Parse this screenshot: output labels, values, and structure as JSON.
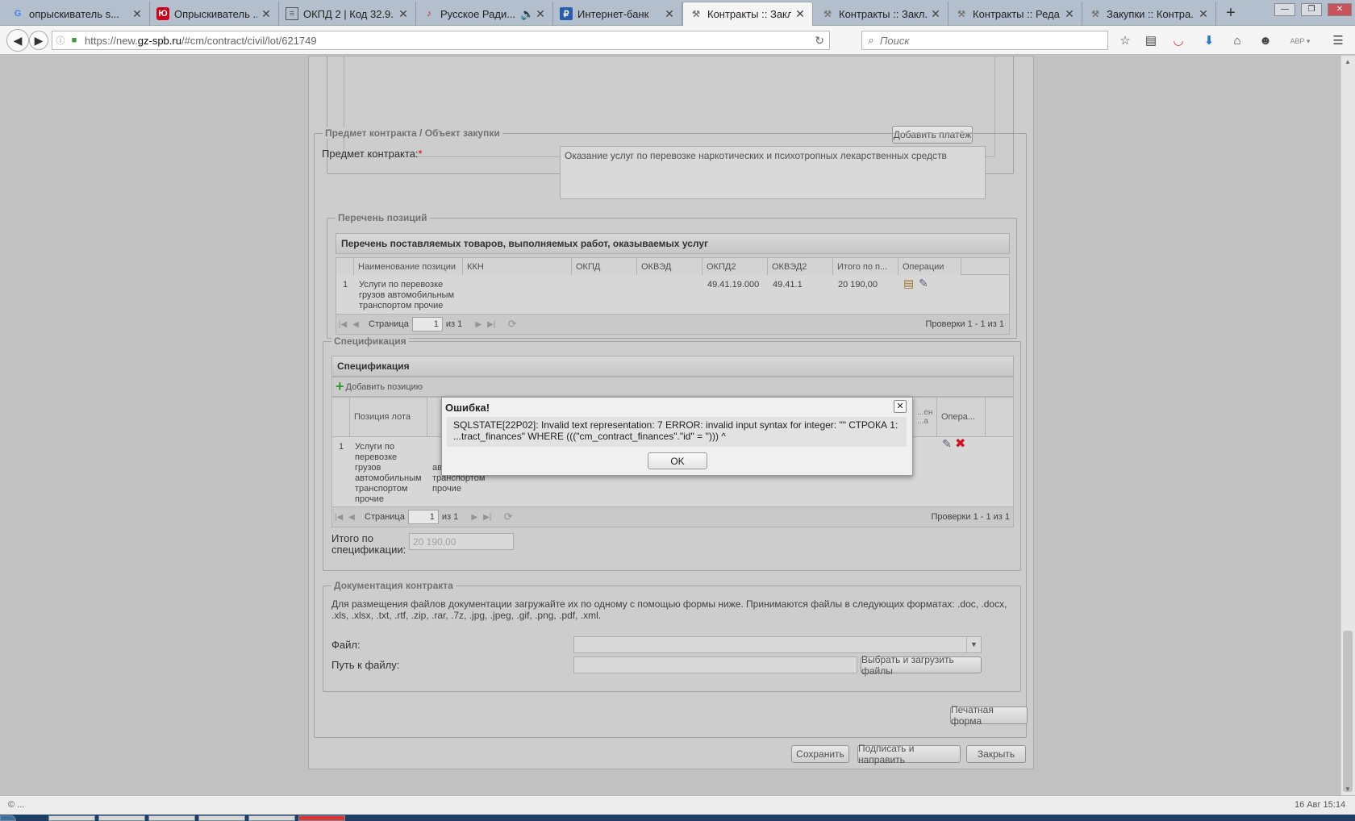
{
  "browser": {
    "tabs": [
      {
        "title": "опрыскиватель s...",
        "icon": "google-icon",
        "color": "#4285f4"
      },
      {
        "title": "Опрыскиватель ...",
        "icon": "yu-logo-icon",
        "color": "#d0021b"
      },
      {
        "title": "ОКПД 2 | Код 32.9...",
        "icon": "document-icon",
        "color": "#555555"
      },
      {
        "title": "Русское Ради...",
        "icon": "radio-icon",
        "color": "#c8102e"
      },
      {
        "title": "Интернет-банк",
        "icon": "bank-icon",
        "color": "#2a5db0"
      },
      {
        "title": "Контракты :: Закл...",
        "icon": "hammer-icon",
        "color": "#777777",
        "active": true
      },
      {
        "title": "Контракты :: Закл...",
        "icon": "hammer-icon",
        "color": "#777777"
      },
      {
        "title": "Контракты :: Реда...",
        "icon": "hammer-icon",
        "color": "#777777"
      },
      {
        "title": "Закупки :: Контра...",
        "icon": "hammer-icon",
        "color": "#777777"
      }
    ],
    "new_tab": "+",
    "url_host": "https://new.",
    "url_domain": "gz-spb.ru",
    "url_path": "/#cm/contract/civil/lot/621749",
    "search_placeholder": "Поиск",
    "abp_label": "ABP"
  },
  "form": {
    "add_payment_button": "Добавить платёж",
    "subject_legend": "Предмет контракта / Объект закупки",
    "subject_label": "Предмет контракта:",
    "required_mark": "*",
    "subject_value": "Оказание услуг по перевозке наркотических и психотропных лекарственных средств",
    "positions_legend": "Перечень позиций",
    "positions_grid_title": "Перечень поставляемых товаров, выполняемых работ, оказываемых услуг",
    "positions_columns": [
      "Наименование позиции",
      "ККН",
      "ОКПД",
      "ОКВЭД",
      "ОКПД2",
      "ОКВЭД2",
      "Итого по п...",
      "Операции"
    ],
    "positions_row": {
      "num": "1",
      "name": "Услуги по перевозке грузов автомобильным транспортом прочие",
      "kkn": "",
      "okpd": "",
      "okved": "",
      "okpd2": "49.41.19.000",
      "okved2": "49.41.1",
      "total": "20 190,00"
    },
    "pager_page_label": "Страница",
    "pager_page_value": "1",
    "pager_of": "из 1",
    "pager_info": "Проверки 1 - 1 из 1",
    "spec_legend": "Спецификация",
    "spec_grid_title": "Спецификация",
    "spec_add": "Добавить позицию",
    "spec_columns": [
      "Позиция лота",
      "...ен ...а",
      "Опера..."
    ],
    "spec_row": {
      "num": "1",
      "position": "Услуги по перевозке грузов автомобильным транспортом прочие",
      "name": "автомобильным транспортом прочие"
    },
    "spec_total_label": "Итого по спецификации:",
    "spec_total_value": "20 190,00",
    "docs_legend": "Документация контракта",
    "docs_hint": "Для размещения файлов документации загружайте их по одному с помощью формы ниже. Принимаются файлы в следующих форматах: .doc, .docx, .xls, .xlsx, .txt, .rtf, .zip, .rar, .7z, .jpg, .jpeg, .gif, .png, .pdf, .xml.",
    "file_label": "Файл:",
    "path_label": "Путь к файлу:",
    "upload_button": "Выбрать и загрузить файлы",
    "print_button": "Печатная форма",
    "save_button": "Сохранить",
    "sign_button": "Подписать и направить",
    "close_button": "Закрыть"
  },
  "dialog": {
    "title": "Ошибка!",
    "message": "SQLSTATE[22P02]: Invalid text representation: 7 ERROR: invalid input syntax for integer: \"\" СТРОКА 1: ...tract_finances\" WHERE (((\"cm_contract_finances\".\"id\" = ''))) ^",
    "ok": "OK"
  },
  "status": {
    "left": "© ...",
    "clock": "16 Авг 15:14"
  }
}
